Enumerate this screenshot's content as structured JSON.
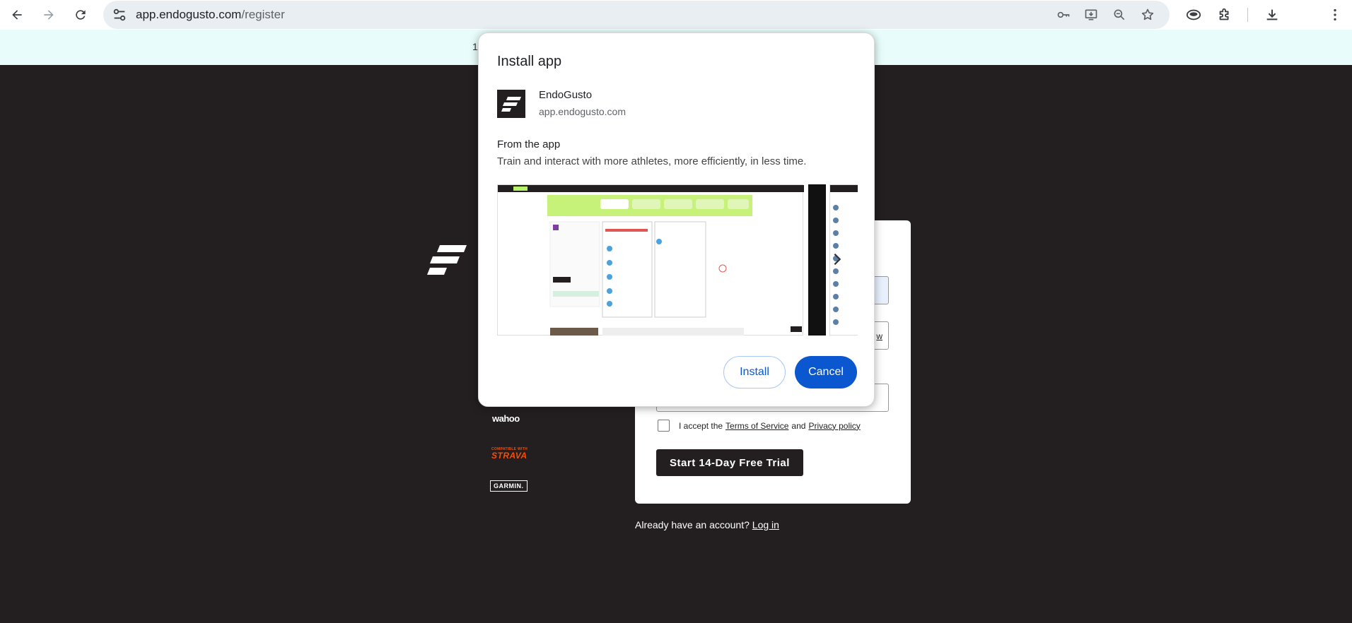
{
  "browser": {
    "url_host": "app.endogusto.com",
    "url_path": "/register",
    "icons": [
      "back-arrow-icon",
      "forward-arrow-icon",
      "reload-icon",
      "site-info-icon",
      "key-icon",
      "install-app-icon",
      "zoom-icon",
      "star-icon",
      "profile-icon",
      "extensions-icon",
      "downloads-icon",
      "menu-icon"
    ]
  },
  "banner": {
    "partial_char": "1"
  },
  "dialog": {
    "title": "Install app",
    "app_name": "EndoGusto",
    "app_domain": "app.endogusto.com",
    "from_app_label": "From the app",
    "description": "Train and interact with more athletes, more efficiently, in less time.",
    "install_label": "Install",
    "cancel_label": "Cancel"
  },
  "page": {
    "partners": {
      "wahoo": "wahoo",
      "strava_small": "COMPATIBLE WITH",
      "strava": "STRAVA",
      "garmin": "GARMIN."
    },
    "field_link_partial": "w",
    "terms_prefix": "I accept the",
    "terms_of_service": "Terms of Service",
    "terms_and": "and",
    "privacy_policy": "Privacy policy",
    "trial_button": "Start 14-Day Free Trial",
    "login_prompt": "Already have an account?",
    "login_link": "Log in"
  },
  "colors": {
    "page_bg": "#231f20",
    "banner_bg": "#e8fdfb",
    "accent_blue": "#0b57d0",
    "strava_orange": "#fc4c02"
  }
}
